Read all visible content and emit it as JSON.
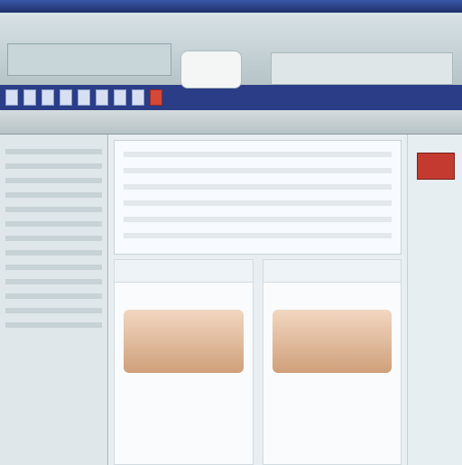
{
  "screenshot": {
    "note": ""
  }
}
